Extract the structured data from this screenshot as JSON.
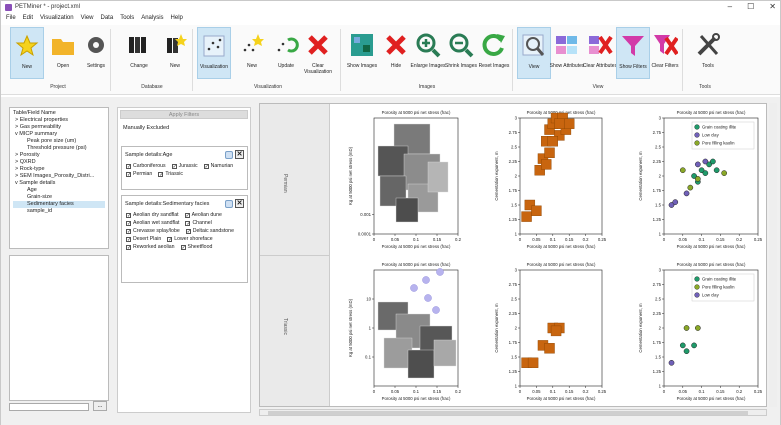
{
  "window": {
    "title": "PETMiner * - project.xml",
    "controls": [
      "–",
      "☐",
      "✕"
    ]
  },
  "menu": [
    "File",
    "Edit",
    "Visualization",
    "View",
    "Data",
    "Tools",
    "Analysis",
    "Help"
  ],
  "ribbon": {
    "buttons": [
      {
        "label": "New",
        "icon": "star-new-icon",
        "active": true
      },
      {
        "label": "Open",
        "icon": "folder-icon"
      },
      {
        "label": "Settings",
        "icon": "gear-icon"
      },
      {
        "label": "Change",
        "icon": "binders-icon"
      },
      {
        "label": "New",
        "icon": "binders-star-icon"
      },
      {
        "label": "Visualization",
        "icon": "scatter-grid-icon",
        "active": true
      },
      {
        "label": "New",
        "icon": "scatter-star-icon"
      },
      {
        "label": "Update",
        "icon": "scatter-refresh-icon"
      },
      {
        "label": "Clear Visualization",
        "icon": "red-x-icon"
      },
      {
        "label": "Show Images",
        "icon": "images-icon"
      },
      {
        "label": "Hide",
        "icon": "red-x-icon"
      },
      {
        "label": "Enlarge Images",
        "icon": "zoom-in-icon"
      },
      {
        "label": "Shrink Images",
        "icon": "zoom-out-icon"
      },
      {
        "label": "Reset Images",
        "icon": "refresh-arrow-icon"
      },
      {
        "label": "View",
        "icon": "magnifier-grid-icon",
        "active": true
      },
      {
        "label": "Show Attributes",
        "icon": "attributes-icon"
      },
      {
        "label": "Clear Attributes",
        "icon": "clear-attributes-icon"
      },
      {
        "label": "Show Filters",
        "icon": "filter-icon",
        "active": true
      },
      {
        "label": "Clear Filters",
        "icon": "clear-filter-icon"
      },
      {
        "label": "Tools",
        "icon": "tools-icon"
      }
    ],
    "groups": [
      "Project",
      "Database",
      "Visualization",
      "Images",
      "View",
      "Tools"
    ]
  },
  "tree": {
    "header": "Table/Field Name",
    "items": [
      {
        "label": "Electrical properties",
        "prefix": ">",
        "indent": 0
      },
      {
        "label": "Gas permeability",
        "prefix": ">",
        "indent": 0
      },
      {
        "label": "MICP summary",
        "prefix": "v",
        "indent": 0
      },
      {
        "label": "Peak pore size (um)",
        "prefix": "",
        "indent": 2
      },
      {
        "label": "Threshold pressure (psi)",
        "prefix": "",
        "indent": 2
      },
      {
        "label": "Porosity",
        "prefix": ">",
        "indent": 0
      },
      {
        "label": "QXRD",
        "prefix": ">",
        "indent": 0
      },
      {
        "label": "Rock-type",
        "prefix": ">",
        "indent": 0
      },
      {
        "label": "SEM Images_Porosity_Distri...",
        "prefix": ">",
        "indent": 0
      },
      {
        "label": "Sample details",
        "prefix": "v",
        "indent": 0
      },
      {
        "label": "Age",
        "prefix": "",
        "indent": 2
      },
      {
        "label": "Grain-size",
        "prefix": "",
        "indent": 2
      },
      {
        "label": "Sedimentary facies",
        "prefix": "",
        "indent": 2,
        "selected": true
      },
      {
        "label": "sample_id",
        "prefix": "",
        "indent": 2
      }
    ]
  },
  "filters": {
    "apply": "Apply Filters",
    "manual": "Manually Excluded",
    "age": {
      "title": "Sample details:Age",
      "options": [
        {
          "label": "Carboniferous",
          "checked": true
        },
        {
          "label": "Jurassic",
          "checked": true
        },
        {
          "label": "Namurian",
          "checked": true
        },
        {
          "label": "Permian",
          "checked": true
        },
        {
          "label": "Triassic",
          "checked": true
        }
      ]
    },
    "facies": {
      "title": "Sample details:Sedimentary facies",
      "options": [
        {
          "label": "Aeolian dry sandflat",
          "checked": true
        },
        {
          "label": "Aeolian dune",
          "checked": true
        },
        {
          "label": "Aeolian wet sandflat",
          "checked": true
        },
        {
          "label": "Channel",
          "checked": true
        },
        {
          "label": "Crevasse splay/lobe",
          "checked": true
        },
        {
          "label": "Deltaic sandstone",
          "checked": true
        },
        {
          "label": "Desert Plain",
          "checked": true
        },
        {
          "label": "Lower shoreface",
          "checked": true
        },
        {
          "label": "Reworked aeolian",
          "checked": true
        },
        {
          "label": "Sheetflood",
          "checked": true
        }
      ]
    },
    "browse": "..."
  },
  "rows": [
    "Permian",
    "Triassic"
  ],
  "chart_data": [
    {
      "type": "scatter",
      "panel": "Permian-perm",
      "xlabel": "Porosity at 5000 psi net stress (frac)",
      "ylabel": "Kg at 5000 psi net stress (mD)",
      "xlim": [
        0,
        0.2
      ],
      "ylim_log": [
        0.0001,
        100
      ],
      "xticks": [
        "0",
        "0.05",
        "0.1",
        "0.15",
        "0.2"
      ],
      "yticks": [
        "0.0001",
        "0.001"
      ]
    },
    {
      "type": "scatter",
      "panel": "Permian-cem",
      "xlabel": "Porosity at 5000 psi net stress (frac)",
      "ylabel": "Cementation exponent, m",
      "xlim": [
        0,
        0.25
      ],
      "ylim": [
        1.0,
        3.0
      ],
      "xticks": [
        "0",
        "0.05",
        "0.1",
        "0.15",
        "0.2",
        "0.25"
      ],
      "yticks": [
        "1",
        "1.25",
        "1.5",
        "1.75",
        "2",
        "2.25",
        "2.5",
        "2.75",
        "3"
      ]
    },
    {
      "type": "scatter",
      "panel": "Permian-clay",
      "xlabel": "Porosity at 5000 psi net stress (frac)",
      "ylabel": "Cementation exponent, m",
      "xlim": [
        0,
        0.25
      ],
      "ylim": [
        1.0,
        3.0
      ],
      "xticks": [
        "0",
        "0.05",
        "0.1",
        "0.15",
        "0.2",
        "0.25"
      ],
      "yticks": [
        "1",
        "1.25",
        "1.5",
        "1.75",
        "2",
        "2.25",
        "2.5",
        "2.75",
        "3"
      ],
      "series": [
        {
          "name": "Grain coating illite",
          "color": "#1f9a6a",
          "x": [
            0.08,
            0.1,
            0.12,
            0.13,
            0.14,
            0.11,
            0.09
          ],
          "y": [
            2.0,
            2.1,
            2.2,
            2.25,
            2.1,
            2.05,
            1.9
          ]
        },
        {
          "name": "Low clay",
          "color": "#7060b8",
          "x": [
            0.02,
            0.03,
            0.06,
            0.09,
            0.11
          ],
          "y": [
            1.5,
            1.55,
            1.7,
            2.2,
            2.25
          ]
        },
        {
          "name": "Pore filling kaolin",
          "color": "#8aa828",
          "x": [
            0.05,
            0.07,
            0.09,
            0.16
          ],
          "y": [
            2.1,
            1.8,
            1.95,
            2.05
          ]
        }
      ]
    },
    {
      "type": "scatter",
      "panel": "Triassic-perm",
      "xlabel": "Porosity at 5000 psi net stress (frac)",
      "ylabel": "Kg at 5000 psi net stress (mD)",
      "xlim": [
        0,
        0.2
      ],
      "ylim_log": [
        0.01,
        100
      ],
      "xticks": [
        "0",
        "0.05",
        "0.1",
        "0.15",
        "0.2"
      ],
      "yticks": [
        "0.1",
        "1",
        "10"
      ]
    },
    {
      "type": "scatter",
      "panel": "Triassic-cem",
      "xlabel": "Porosity at 5000 psi net stress (frac)",
      "ylabel": "Cementation exponent, m",
      "xlim": [
        0,
        0.25
      ],
      "ylim": [
        1.0,
        3.0
      ],
      "xticks": [
        "0",
        "0.05",
        "0.1",
        "0.15",
        "0.2",
        "0.25"
      ],
      "yticks": [
        "1",
        "1.25",
        "1.5",
        "1.75",
        "2",
        "2.25",
        "2.5",
        "2.75",
        "3"
      ]
    },
    {
      "type": "scatter",
      "panel": "Triassic-clay",
      "xlabel": "Porosity at 5000 psi net stress (frac)",
      "ylabel": "Cementation exponent, m",
      "xlim": [
        0,
        0.25
      ],
      "ylim": [
        1.0,
        3.0
      ],
      "xticks": [
        "0",
        "0.05",
        "0.1",
        "0.15",
        "0.2",
        "0.25"
      ],
      "yticks": [
        "1",
        "1.25",
        "1.5",
        "1.75",
        "2",
        "2.25",
        "2.5",
        "2.75",
        "3"
      ],
      "series": [
        {
          "name": "Grain coating illite",
          "color": "#1f9a6a",
          "x": [
            0.05,
            0.08,
            0.06
          ],
          "y": [
            1.7,
            1.7,
            1.6
          ]
        },
        {
          "name": "Pore filling kaolin",
          "color": "#8aa828",
          "x": [
            0.06,
            0.09
          ],
          "y": [
            2.0,
            2.0
          ]
        },
        {
          "name": "Low clay",
          "color": "#7060b8",
          "x": [
            0.02
          ],
          "y": [
            1.4
          ]
        }
      ]
    }
  ]
}
